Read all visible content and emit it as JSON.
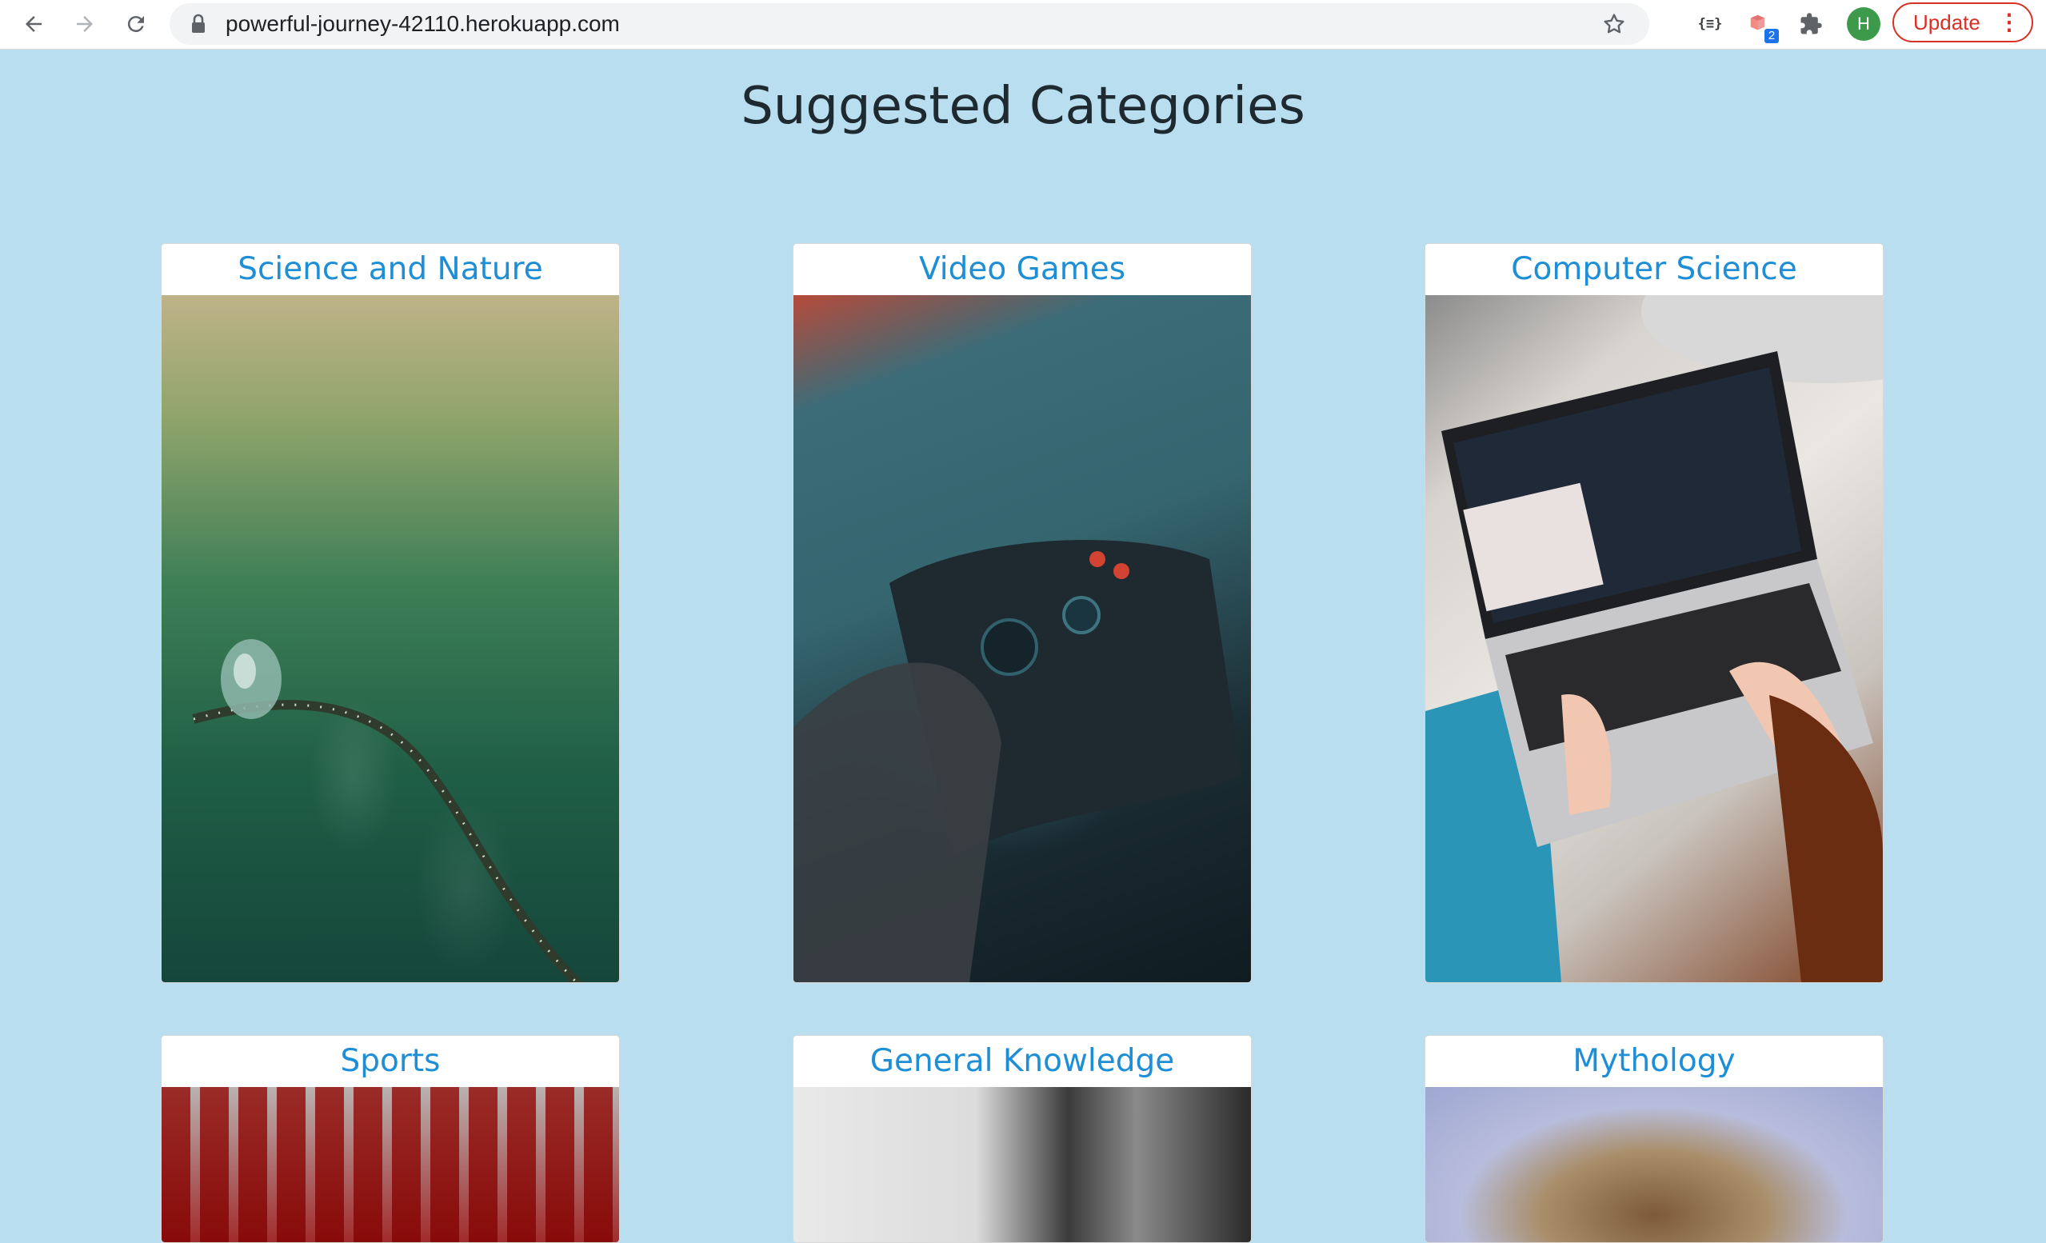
{
  "browser": {
    "url": "powerful-journey-42110.herokuapp.com",
    "extensions": [
      {
        "icon": "json-viewer-icon",
        "label": "{≡}"
      },
      {
        "icon": "cast-extension-icon",
        "badge": "2"
      },
      {
        "icon": "puzzle-icon"
      }
    ],
    "avatar_initial": "H",
    "update_label": "Update"
  },
  "page": {
    "title": "Suggested Categories"
  },
  "categories": [
    {
      "label": "Science and Nature",
      "image": "water-droplet-on-grass"
    },
    {
      "label": "Video Games",
      "image": "game-controller"
    },
    {
      "label": "Computer Science",
      "image": "person-typing-on-laptop"
    },
    {
      "label": "Sports",
      "image": "stadium-seats"
    },
    {
      "label": "General Knowledge",
      "image": "bookshelf"
    },
    {
      "label": "Mythology",
      "image": "ornate-painting"
    }
  ],
  "colors": {
    "background": "#b8def0",
    "card_title": "#1e8fd6",
    "update": "#d93025"
  }
}
